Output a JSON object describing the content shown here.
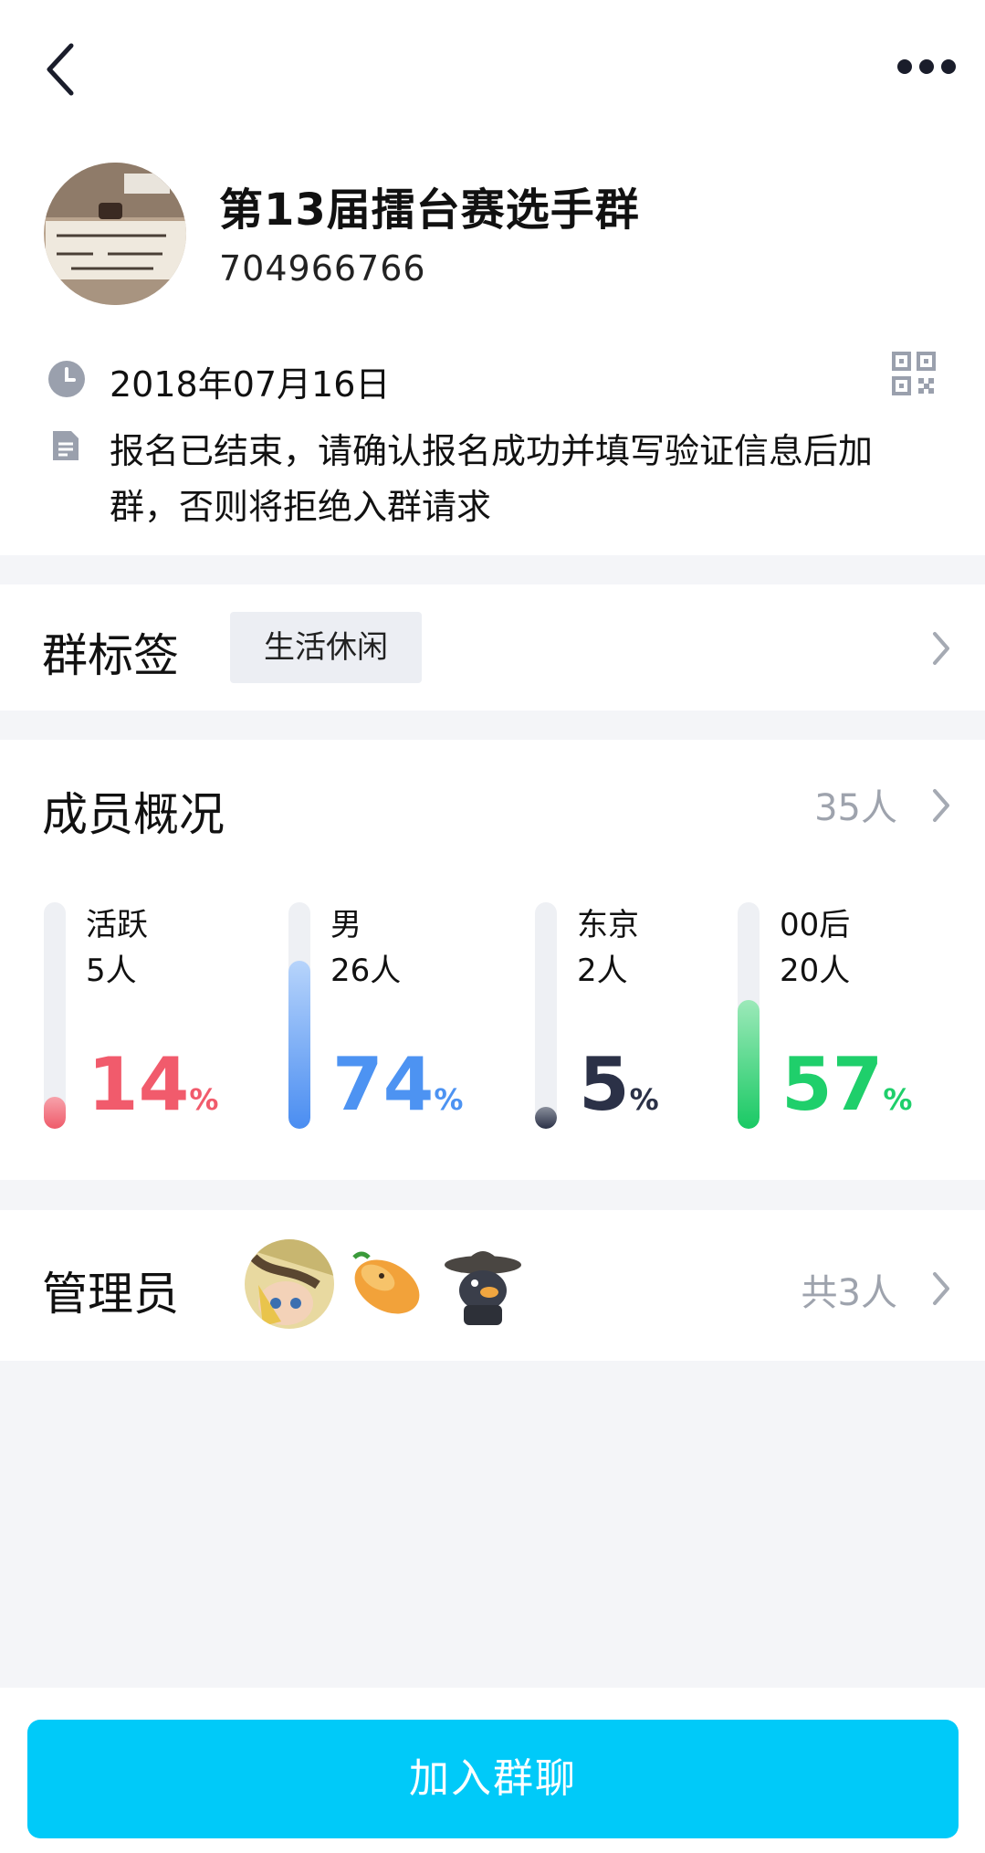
{
  "group": {
    "name": "第13届擂台赛选手群",
    "id": "704966766",
    "date": "2018年07月16日",
    "description": "报名已结束，请确认报名成功并填写验证信息后加群，否则将拒绝入群请求",
    "avatar_icon": "group-avatar-image"
  },
  "tags": {
    "title": "群标签",
    "items": [
      "生活休闲"
    ]
  },
  "members": {
    "title": "成员概况",
    "total": "35人",
    "stats": [
      {
        "label": "活跃",
        "count": "5人",
        "percent": "14",
        "value": 0.14,
        "unit": "%",
        "color": "#f15b6c",
        "fill_from": "#f7a2ab",
        "fill_to": "#ef5b6a"
      },
      {
        "label": "男",
        "count": "26人",
        "percent": "74",
        "value": 0.74,
        "unit": "%",
        "color": "#4d93f2",
        "fill_from": "#b7d4fb",
        "fill_to": "#4a8df1"
      },
      {
        "label": "东京",
        "count": "2人",
        "percent": "5",
        "value": 0.05,
        "unit": "%",
        "color": "#2b3147",
        "fill_from": "#8a8f9c",
        "fill_to": "#2b3147"
      },
      {
        "label": "00后",
        "count": "20人",
        "percent": "57",
        "value": 0.57,
        "unit": "%",
        "color": "#1fcf6b",
        "fill_from": "#9ce9b9",
        "fill_to": "#19c964"
      }
    ]
  },
  "admins": {
    "title": "管理员",
    "total": "共3人",
    "avatars": [
      "admin-avatar-1",
      "admin-avatar-2",
      "admin-avatar-3"
    ]
  },
  "join_button": "加入群聊"
}
